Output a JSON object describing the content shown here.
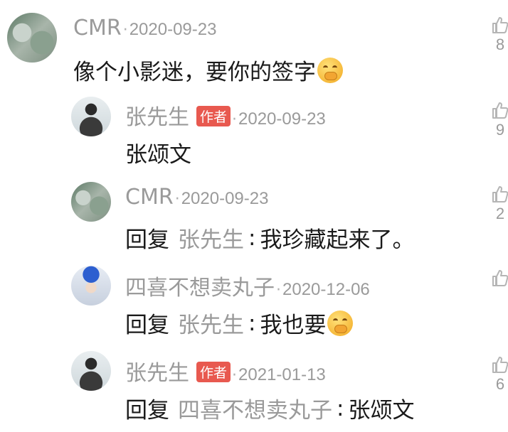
{
  "comments": [
    {
      "username": "CMR",
      "dot": "·",
      "date": "2020-09-23",
      "author_badge": "",
      "text": "像个小影迷，要你的签字",
      "emoji": "covering-mouth-emoji",
      "likes": "8"
    },
    {
      "username": "张先生",
      "dot": "·",
      "date": "2020-09-23",
      "author_badge": "作者",
      "text": "张颂文",
      "emoji": "",
      "likes": "9"
    },
    {
      "username": "CMR",
      "dot": "·",
      "date": "2020-09-23",
      "author_badge": "",
      "reply_word": "回复",
      "reply_to": "张先生",
      "colon": ":",
      "text": "我珍藏起来了。",
      "emoji": "",
      "likes": "2"
    },
    {
      "username": "四喜不想卖丸子",
      "dot": "·",
      "date": "2020-12-06",
      "author_badge": "",
      "reply_word": "回复",
      "reply_to": "张先生",
      "colon": ":",
      "text": "我也要",
      "emoji": "covering-mouth-emoji",
      "likes": ""
    },
    {
      "username": "张先生",
      "dot": "·",
      "date": "2021-01-13",
      "author_badge": "作者",
      "reply_word": "回复",
      "reply_to": "四喜不想卖丸子",
      "colon": ":",
      "text": "张颂文",
      "emoji": "",
      "likes": "6"
    }
  ],
  "icons": {
    "like": "thumbs-up-icon",
    "avatar": "user-avatar"
  },
  "colors": {
    "badge": "#e8594f",
    "secondary_text": "#9a9a9a",
    "primary_text": "#1a1a1a"
  }
}
